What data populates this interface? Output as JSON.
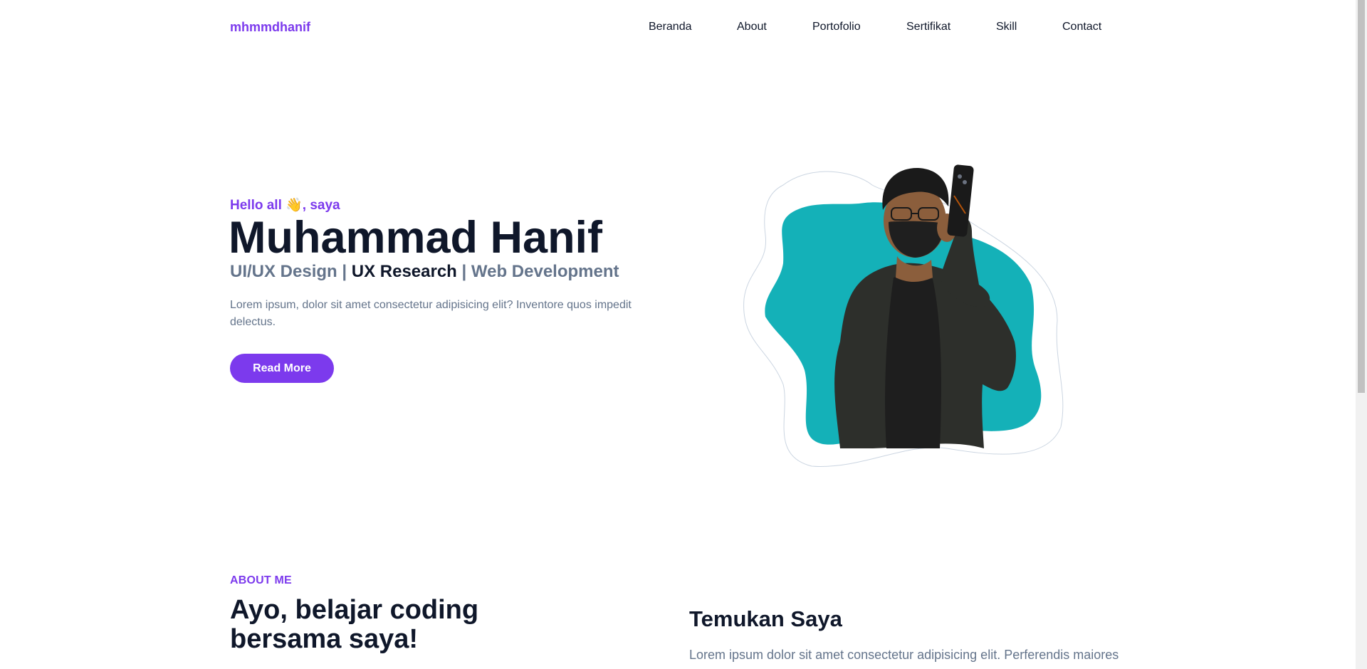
{
  "navbar": {
    "brand": "mhmmdhanif",
    "links": [
      "Beranda",
      "About",
      "Portofolio",
      "Sertifikat",
      "Skill",
      "Contact"
    ]
  },
  "hero": {
    "greeting": "Hello all 👋, saya",
    "name": "Muhammad Hanif",
    "roles": {
      "role1": "UI/UX Design",
      "sep1": " | ",
      "role2": "UX Research",
      "sep2": " | ",
      "role3": "Web Development"
    },
    "description": "Lorem ipsum, dolor sit amet consectetur adipisicing elit? Inventore quos impedit delectus.",
    "cta_label": "Read More"
  },
  "about": {
    "eyebrow": "ABOUT ME",
    "heading": "Ayo, belajar coding bersama saya!",
    "find_heading": "Temukan Saya",
    "find_text": "Lorem ipsum dolor sit amet consectetur adipisicing elit. Perferendis maiores"
  },
  "colors": {
    "accent": "#7c3aed",
    "text_dark": "#0f172a",
    "text_muted": "#64748b",
    "blob": "#14b1b8"
  },
  "icons": {
    "wave": "waving-hand-icon"
  }
}
